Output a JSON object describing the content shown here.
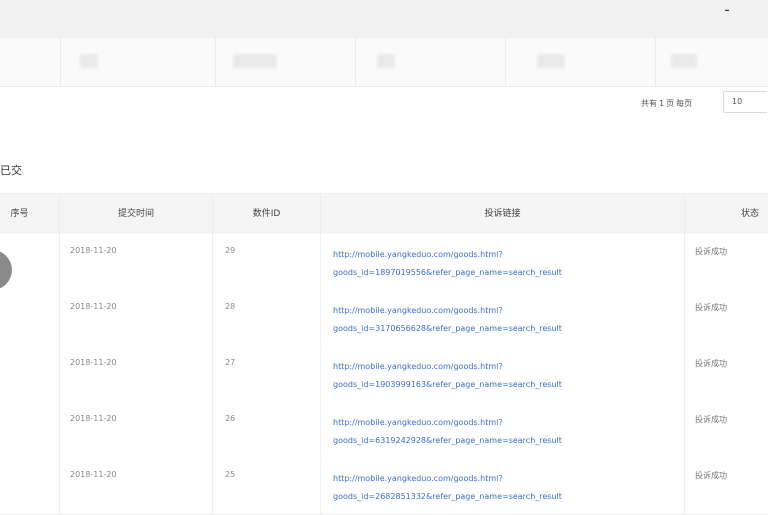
{
  "header": {
    "collapse_icon": "dash-icon"
  },
  "pagination": {
    "total_prefix": "共有",
    "total_count": "1",
    "total_suffix": "页",
    "per_page_label": "每页",
    "page_size": "10"
  },
  "section": {
    "title": "已交"
  },
  "table": {
    "columns": [
      "序号",
      "提交时间",
      "数件ID",
      "投诉链接",
      "状态"
    ],
    "rows": [
      {
        "date": "2018-11-20",
        "id": "29",
        "link_line1": "http://mobile.yangkeduo.com/goods.html?",
        "link_line2": "goods_id=1897019556&refer_page_name=search_result",
        "status": "投诉成功"
      },
      {
        "date": "2018-11-20",
        "id": "28",
        "link_line1": "http://mobile.yangkeduo.com/goods.html?",
        "link_line2": "goods_id=3170656628&refer_page_name=search_result",
        "status": "投诉成功"
      },
      {
        "date": "2018-11-20",
        "id": "27",
        "link_line1": "http://mobile.yangkeduo.com/goods.html?",
        "link_line2": "goods_id=1903999163&refer_page_name=search_result",
        "status": "投诉成功"
      },
      {
        "date": "2018-11-20",
        "id": "26",
        "link_line1": "http://mobile.yangkeduo.com/goods.html?",
        "link_line2": "goods_id=6319242928&refer_page_name=search_result",
        "status": "投诉成功"
      },
      {
        "date": "2018-11-20",
        "id": "25",
        "link_line1": "http://mobile.yangkeduo.com/goods.html?",
        "link_line2": "goods_id=2682851332&refer_page_name=search_result",
        "status": "投诉成功"
      }
    ]
  },
  "colors": {
    "link": "#3a6fc4",
    "header_bg": "#f2f2f2",
    "table_head_bg": "#f5f5f5"
  }
}
